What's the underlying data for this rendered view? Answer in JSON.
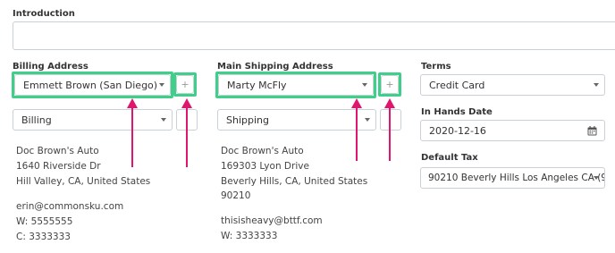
{
  "introduction": {
    "label": "Introduction",
    "value": ""
  },
  "billing": {
    "label": "Billing Address",
    "address_select": "Emmett Brown (San Diego)",
    "add_label": "+",
    "type_select": "Billing",
    "lines": [
      "Doc Brown's Auto",
      "1640 Riverside Dr",
      "Hill Valley, CA, United States"
    ],
    "email": "erin@commonsku.com",
    "work_phone": "W: 5555555",
    "cell_phone": "C: 3333333"
  },
  "shipping": {
    "label": "Main Shipping Address",
    "address_select": "Marty McFly",
    "add_label": "+",
    "type_select": "Shipping",
    "lines": [
      "Doc Brown's Auto",
      "169303 Lyon Drive",
      "Beverly Hills, CA, United States",
      "90210"
    ],
    "email": "thisisheavy@bttf.com",
    "work_phone": "W: 3333333"
  },
  "terms": {
    "label": "Terms",
    "value": "Credit Card"
  },
  "in_hands": {
    "label": "In Hands Date",
    "value": "2020-12-16"
  },
  "default_tax": {
    "label": "Default Tax",
    "value": "90210 Beverly Hills Los Angeles CA (9..."
  },
  "colors": {
    "highlight": "#3fcf8b",
    "arrow": "#e0156f",
    "border": "#c9d0d6"
  },
  "icons": {
    "dropdown": "caret-down-icon",
    "calendar": "calendar-icon"
  }
}
